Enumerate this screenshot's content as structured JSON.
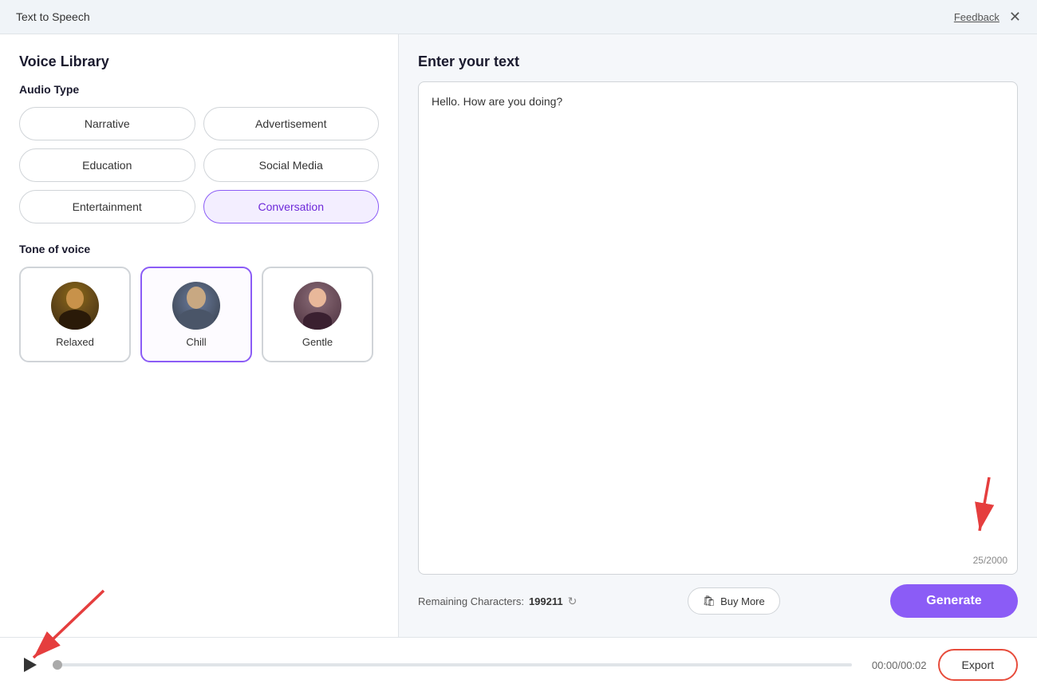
{
  "titleBar": {
    "title": "Text to Speech",
    "feedbackLabel": "Feedback",
    "closeLabel": "✕"
  },
  "leftPanel": {
    "heading": "Voice Library",
    "audioTypeTitle": "Audio Type",
    "audioTypes": [
      {
        "id": "narrative",
        "label": "Narrative",
        "active": false
      },
      {
        "id": "advertisement",
        "label": "Advertisement",
        "active": false
      },
      {
        "id": "education",
        "label": "Education",
        "active": false
      },
      {
        "id": "social-media",
        "label": "Social Media",
        "active": false
      },
      {
        "id": "entertainment",
        "label": "Entertainment",
        "active": false
      },
      {
        "id": "conversation",
        "label": "Conversation",
        "active": true
      }
    ],
    "toneTitle": "Tone of voice",
    "tones": [
      {
        "id": "relaxed",
        "label": "Relaxed",
        "active": false
      },
      {
        "id": "chill",
        "label": "Chill",
        "active": true
      },
      {
        "id": "gentle",
        "label": "Gentle",
        "active": false
      }
    ]
  },
  "rightPanel": {
    "heading": "Enter your text",
    "textValue": "Hello. How are you doing?",
    "charCount": "25/2000",
    "remainingLabel": "Remaining Characters:",
    "remainingValue": "199211",
    "buyMoreLabel": "Buy More",
    "generateLabel": "Generate"
  },
  "playerBar": {
    "timeDisplay": "00:00/00:02",
    "exportLabel": "Export"
  }
}
